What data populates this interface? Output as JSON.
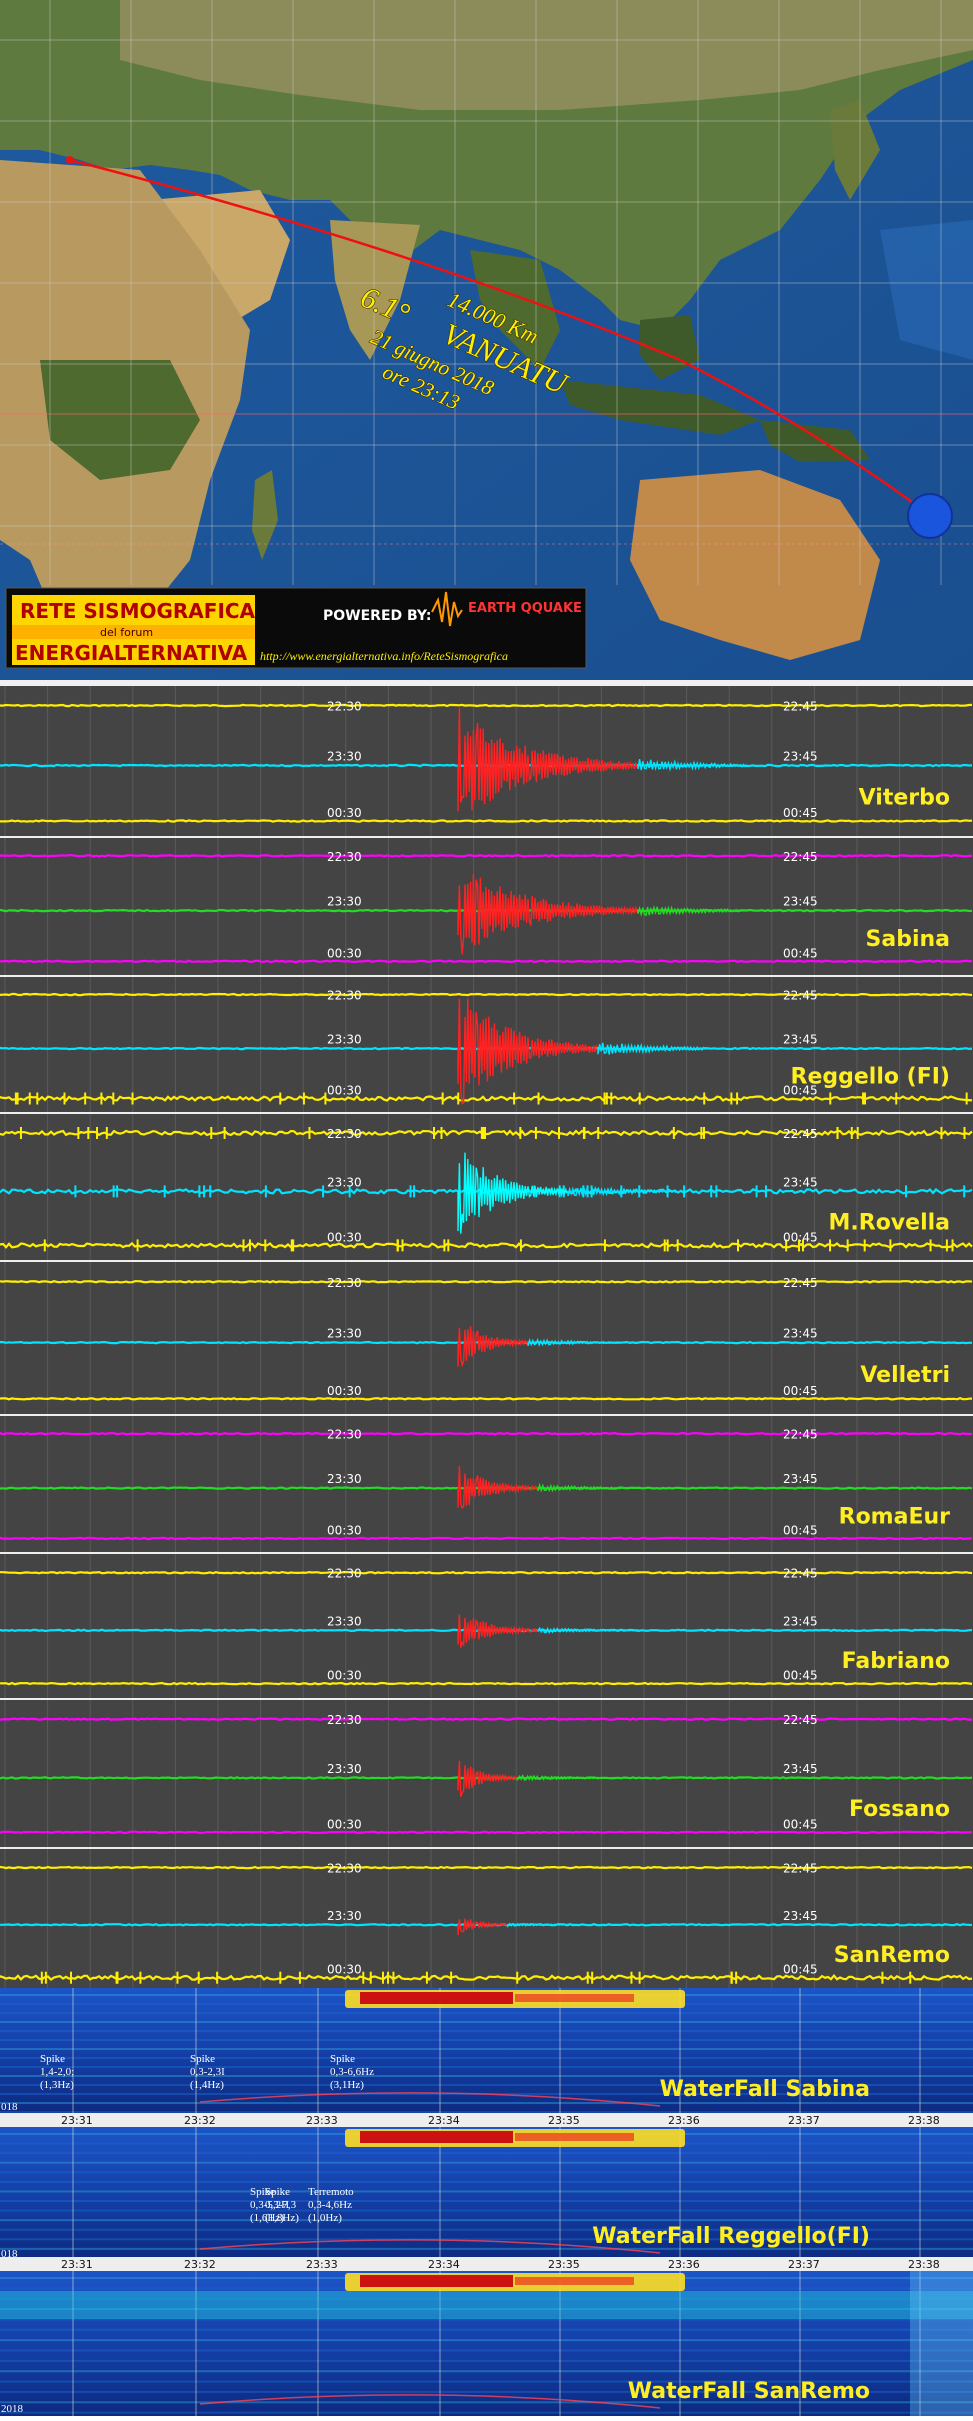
{
  "map": {
    "distance": "14.000 Km",
    "magnitude": "6.1°",
    "place": "VANUATU",
    "date": "21 giugno 2018",
    "time": "ore 23:13"
  },
  "banner": {
    "title": "RETE SISMOGRAFICA",
    "subtitle": "del forum",
    "forum": "ENERGIALTERNATIVA",
    "powered_by": "POWERED BY:",
    "logo_text": "EARTH QQUAKE",
    "url": "http://www.energialternativa.info/ReteSismografica"
  },
  "seismograms": [
    {
      "station": "Viterbo",
      "top_left": "22:30",
      "top_right": "22:45",
      "mid_left": "23:30",
      "mid_right": "23:45",
      "bot_left": "00:30",
      "bot_right": "00:45",
      "top_color": "#ffee00",
      "mid_color": "#00e5ff",
      "bot_color": "#ffee00"
    },
    {
      "station": "Sabina",
      "top_left": "22:30",
      "top_right": "22:45",
      "mid_left": "23:30",
      "mid_right": "23:45",
      "bot_left": "00:30",
      "bot_right": "00:45",
      "top_color": "#ff00ff",
      "mid_color": "#22dd22",
      "bot_color": "#ff00ff"
    },
    {
      "station": "Reggello (FI)",
      "top_left": "22:30",
      "top_right": "22:45",
      "mid_left": "23:30",
      "mid_right": "23:45",
      "bot_left": "00:30",
      "bot_right": "00:45",
      "top_color": "#ffee00",
      "mid_color": "#00e5ff",
      "bot_color": "#ffee00"
    },
    {
      "station": "M.Rovella",
      "top_left": "22:30",
      "top_right": "22:45",
      "mid_left": "23:30",
      "mid_right": "23:45",
      "bot_left": "00:30",
      "bot_right": "00:45",
      "top_color": "#ffee00",
      "mid_color": "#00e5ff",
      "bot_color": "#ffee00"
    },
    {
      "station": "Velletri",
      "top_left": "22:30",
      "top_right": "22:45",
      "mid_left": "23:30",
      "mid_right": "23:45",
      "bot_left": "00:30",
      "bot_right": "00:45",
      "top_color": "#ffee00",
      "mid_color": "#00e5ff",
      "bot_color": "#ffee00"
    },
    {
      "station": "RomaEur",
      "top_left": "22:30",
      "top_right": "22:45",
      "mid_left": "23:30",
      "mid_right": "23:45",
      "bot_left": "00:30",
      "bot_right": "00:45",
      "top_color": "#ff00ff",
      "mid_color": "#22dd22",
      "bot_color": "#ff00ff"
    },
    {
      "station": "Fabriano",
      "top_left": "22:30",
      "top_right": "22:45",
      "mid_left": "23:30",
      "mid_right": "23:45",
      "bot_left": "00:30",
      "bot_right": "00:45",
      "top_color": "#ffee00",
      "mid_color": "#00e5ff",
      "bot_color": "#ffee00"
    },
    {
      "station": "Fossano",
      "top_left": "22:30",
      "top_right": "22:45",
      "mid_left": "23:30",
      "mid_right": "23:45",
      "bot_left": "00:30",
      "bot_right": "00:45",
      "top_color": "#ff00ff",
      "mid_color": "#22dd22",
      "bot_color": "#ff00ff"
    },
    {
      "station": "SanRemo",
      "top_left": "22:30",
      "top_right": "22:45",
      "mid_left": "23:30",
      "mid_right": "23:45",
      "bot_left": "00:30",
      "bot_right": "00:45",
      "top_color": "#ffee00",
      "mid_color": "#00e5ff",
      "bot_color": "#ffee00"
    }
  ],
  "waterfalls": [
    {
      "title": "WaterFall Sabina",
      "year_stub": "018",
      "notes": [
        {
          "l1": "Spike",
          "l2": "1,4-2,0;",
          "l3": "(1,3Hz)"
        },
        {
          "l1": "Spike",
          "l2": "0,3-2,3I",
          "l3": "(1,4Hz)"
        },
        {
          "l1": "Spike",
          "l2": "0,3-6,6Hz",
          "l3": "(3,1Hz)"
        }
      ]
    },
    {
      "title": "WaterFall Reggello(FI)",
      "year_stub": "018",
      "notes": [
        {
          "l1": "Spike",
          "l2": "0,3-5,2H",
          "l3": "(1,6Hz)"
        },
        {
          "l1": "Spike",
          "l2": "0,3-7,3",
          "l3": "(1,8Hz)"
        },
        {
          "l1": "Terremoto",
          "l2": "0,3-4,6Hz",
          "l3": "(1,0Hz)"
        }
      ]
    },
    {
      "title": "WaterFall SanRemo",
      "year_stub": "2018",
      "notes": []
    }
  ],
  "wf_ticks": [
    "23:31",
    "23:32",
    "23:33",
    "23:34",
    "23:35",
    "23:36",
    "23:37",
    "23:38"
  ]
}
